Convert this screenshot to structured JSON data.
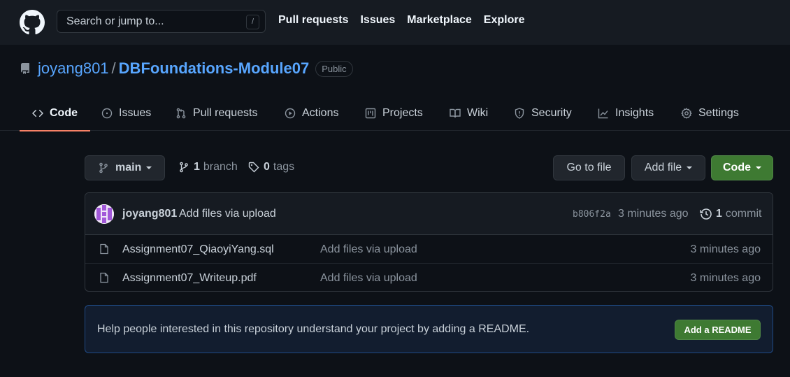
{
  "header": {
    "search_placeholder": "Search or jump to...",
    "search_shortcut": "/",
    "nav": [
      "Pull requests",
      "Issues",
      "Marketplace",
      "Explore"
    ]
  },
  "repo": {
    "owner": "joyang801",
    "separator": "/",
    "name": "DBFoundations-Module07",
    "visibility": "Public"
  },
  "tabs": [
    "Code",
    "Issues",
    "Pull requests",
    "Actions",
    "Projects",
    "Wiki",
    "Security",
    "Insights",
    "Settings"
  ],
  "toolbar": {
    "branch": "main",
    "branch_count": "1",
    "branch_label": "branch",
    "tag_count": "0",
    "tag_label": "tags",
    "go_to_file": "Go to file",
    "add_file": "Add file",
    "code": "Code"
  },
  "latest_commit": {
    "author": "joyang801",
    "message": "Add files via upload",
    "sha": "b806f2a",
    "time": "3 minutes ago",
    "count": "1",
    "count_label": "commit"
  },
  "files": [
    {
      "name": "Assignment07_QiaoyiYang.sql",
      "message": "Add files via upload",
      "age": "3 minutes ago"
    },
    {
      "name": "Assignment07_Writeup.pdf",
      "message": "Add files via upload",
      "age": "3 minutes ago"
    }
  ],
  "readme_banner": {
    "text": "Help people interested in this repository understand your project by adding a README.",
    "button": "Add a README"
  },
  "colors": {
    "background": "#0d1117",
    "header": "#161b22",
    "link": "#58a6ff",
    "accent_tab": "#f78166",
    "primary_button": "#3e7a32"
  }
}
